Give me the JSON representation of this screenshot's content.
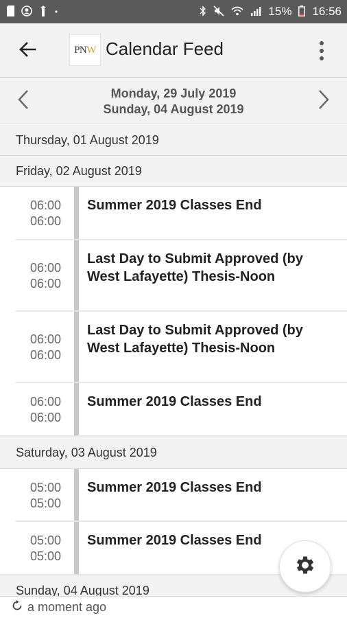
{
  "status_bar": {
    "battery": "15%",
    "time": "16:56"
  },
  "app_bar": {
    "title": "Calendar Feed",
    "logo_text_pn": "PN",
    "logo_text_w": "W"
  },
  "week_nav": {
    "start": "Monday, 29 July 2019",
    "end": "Sunday, 04 August 2019"
  },
  "days": [
    {
      "header": "Thursday, 01 August 2019",
      "events": []
    },
    {
      "header": "Friday, 02 August 2019",
      "events": [
        {
          "start": "06:00",
          "end": "06:00",
          "title": "Summer 2019 Classes End"
        },
        {
          "start": "06:00",
          "end": "06:00",
          "title": "Last Day to Submit Approved (by West Lafayette) Thesis-Noon"
        },
        {
          "start": "06:00",
          "end": "06:00",
          "title": "Last Day to Submit Approved (by West Lafayette) Thesis-Noon"
        },
        {
          "start": "06:00",
          "end": "06:00",
          "title": "Summer 2019 Classes End"
        }
      ]
    },
    {
      "header": "Saturday, 03 August 2019",
      "events": [
        {
          "start": "05:00",
          "end": "05:00",
          "title": "Summer 2019 Classes End"
        },
        {
          "start": "05:00",
          "end": "05:00",
          "title": "Summer 2019 Classes End"
        }
      ]
    },
    {
      "header": "Sunday, 04 August 2019",
      "events": []
    }
  ],
  "footer": {
    "updated": "a moment ago"
  },
  "icons": {
    "back": "arrow-left-icon",
    "menu": "more-vert-icon",
    "prev": "chevron-left-icon",
    "next": "chevron-right-icon",
    "settings": "gear-icon",
    "refresh": "refresh-icon"
  }
}
